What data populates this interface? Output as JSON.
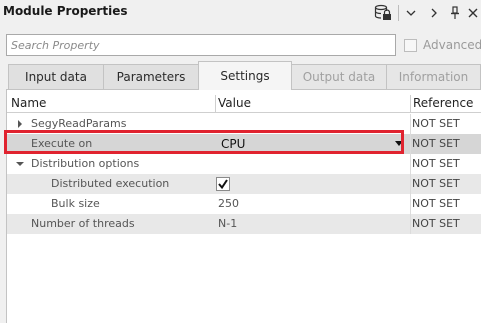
{
  "window": {
    "title": "Module Properties",
    "icons": [
      "database-lock-icon",
      "chevron-down-icon",
      "chevron-right-icon",
      "pin-icon",
      "close-icon"
    ]
  },
  "search": {
    "placeholder": "Search Property",
    "value": ""
  },
  "advanced": {
    "label": "Advanced",
    "checked": false
  },
  "tabs": [
    {
      "label": "Input data",
      "active": false,
      "enabled": true
    },
    {
      "label": "Parameters",
      "active": false,
      "enabled": true
    },
    {
      "label": "Settings",
      "active": true,
      "enabled": true
    },
    {
      "label": "Output data",
      "active": false,
      "enabled": false
    },
    {
      "label": "Information",
      "active": false,
      "enabled": false
    }
  ],
  "table": {
    "columns": [
      "Name",
      "Value",
      "Reference"
    ],
    "rows": [
      {
        "name": "SegyReadParams",
        "value": "",
        "reference": "NOT SET",
        "expander": "collapsed"
      },
      {
        "name": "Execute on",
        "value": "CPU",
        "reference": "NOT SET",
        "dropdown": true
      },
      {
        "name": "Distribution options",
        "value": "",
        "reference": "NOT SET",
        "expander": "expanded"
      },
      {
        "name": "Distributed execution",
        "value": "",
        "reference": "NOT SET",
        "checked": true
      },
      {
        "name": "Bulk size",
        "value": "250",
        "reference": "NOT SET"
      },
      {
        "name": "Number of threads",
        "value": "N-1",
        "reference": "NOT SET"
      }
    ]
  },
  "colors": {
    "highlight": "#e0232f",
    "selected_row": "#d6d6d6",
    "alt_row": "#e8e8e8"
  }
}
